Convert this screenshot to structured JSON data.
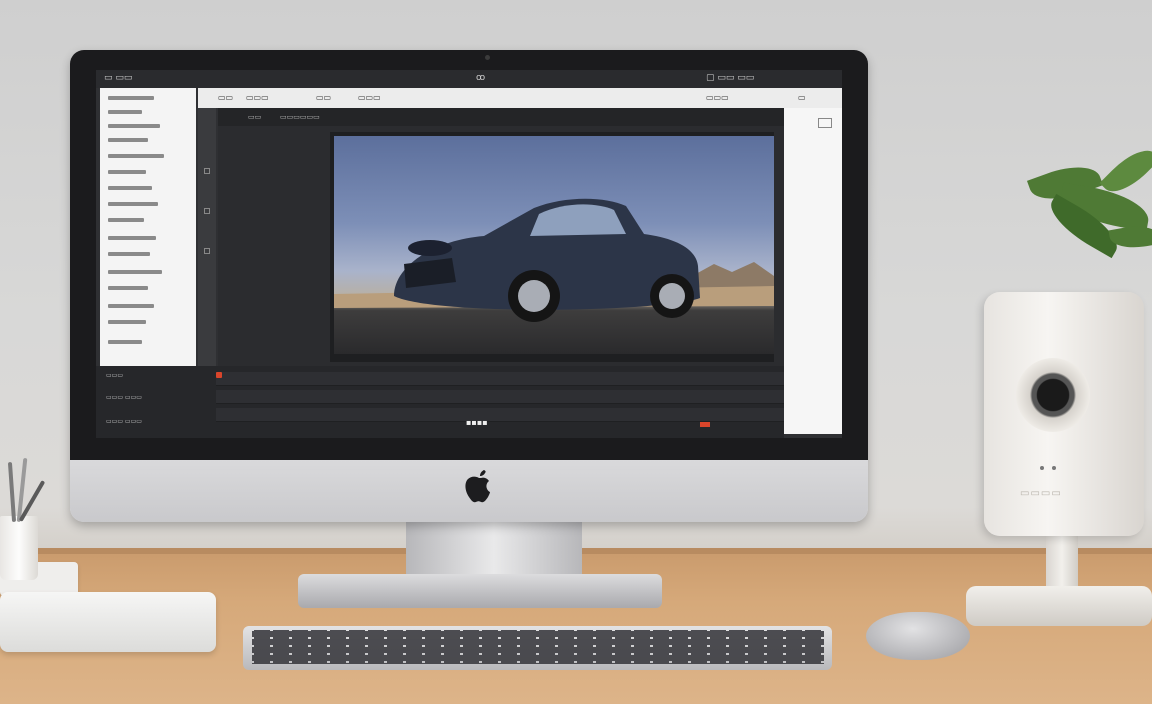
{
  "scene": {
    "screen_app": {
      "menubar": {
        "left_text": "▭ ▭▭",
        "center_text": "ꝏ",
        "right_text": "▢ ▭▭ ▭▭"
      },
      "toolbar": {
        "items": [
          "▭▭",
          "▭▭▭",
          "▭▭",
          "▭▭▭",
          "▭▭▭",
          "▭"
        ]
      },
      "editor_header": {
        "tab": "▭▭",
        "title": "▭▭▭▭▭▭"
      },
      "timecode": "▪▪▪▪",
      "left_panel_rows": 18,
      "timeline_labels": [
        "▭▭▭",
        "▭▭▭ ▭▭▭",
        "▭▭▭ ▭▭▭"
      ]
    },
    "device_label": "▭▭▭▭"
  },
  "colors": {
    "wall": "#d6d6d5",
    "desk": "#d6a97a",
    "screen_bg": "#2f3033",
    "sky_top": "#5c6f9c",
    "car_body": "#2c3548",
    "plant": "#4f7a35"
  },
  "icons": [
    "apple-logo-icon",
    "car-image",
    "speaker-icon",
    "plant-icon"
  ]
}
